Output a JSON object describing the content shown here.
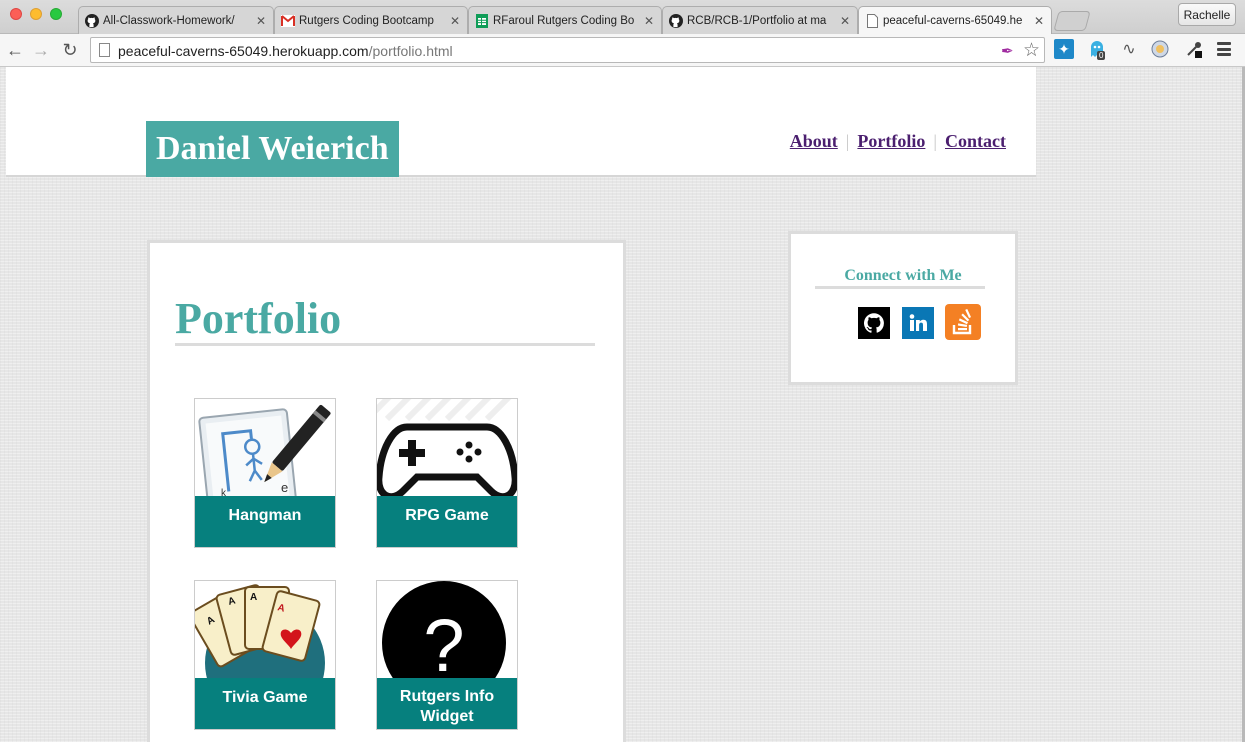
{
  "browser": {
    "tabs": [
      {
        "label": "All-Classwork-Homework/",
        "icon": "github-icon"
      },
      {
        "label": "Rutgers Coding Bootcamp",
        "icon": "gmail-icon"
      },
      {
        "label": "RFaroul Rutgers Coding Bo",
        "icon": "sheets-icon"
      },
      {
        "label": "RCB/RCB-1/Portfolio at ma",
        "icon": "github-icon"
      },
      {
        "label": "peaceful-caverns-65049.he",
        "icon": "page-icon",
        "active": true
      }
    ],
    "profile": "Rachelle",
    "url_host": "peaceful-caverns-65049.herokuapp.com",
    "url_path": "/portfolio.html",
    "ghostery_count": "0"
  },
  "site": {
    "brand": "Daniel Weierich",
    "nav": {
      "about": "About",
      "portfolio": "Portfolio",
      "contact": "Contact",
      "separator": "|"
    },
    "page_title": "Portfolio",
    "projects": [
      {
        "label": "Hangman",
        "icon": "hangman-icon"
      },
      {
        "label": "RPG Game",
        "icon": "gamepad-icon"
      },
      {
        "label": "Tivia Game",
        "icon": "playing-cards-icon"
      },
      {
        "label": "Rutgers Info Widget",
        "icon": "question-mark-icon"
      }
    ],
    "sidebar": {
      "title": "Connect with Me",
      "links": [
        {
          "icon": "github-icon",
          "color": "#000000"
        },
        {
          "icon": "linkedin-icon",
          "color": "#0a77b5"
        },
        {
          "icon": "stackoverflow-icon",
          "color": "#f48024"
        }
      ]
    }
  },
  "colors": {
    "teal": "#4aa9a3",
    "caption_teal": "#06807e",
    "nav_link": "#4b1f6f"
  }
}
